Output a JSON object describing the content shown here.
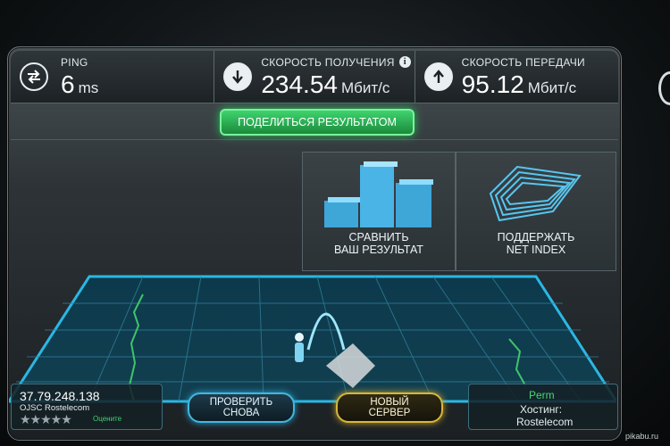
{
  "stats": {
    "ping": {
      "label": "PING",
      "value": "6",
      "unit": "ms"
    },
    "download": {
      "label": "СКОРОСТЬ ПОЛУЧЕНИЯ",
      "value": "234.54",
      "unit": "Мбит/с"
    },
    "upload": {
      "label": "СКОРОСТЬ ПЕРЕДАЧИ",
      "value": "95.12",
      "unit": "Мбит/с"
    }
  },
  "share_label": "ПОДЕЛИТЬСЯ РЕЗУЛЬТАТОМ",
  "panels": {
    "compare": {
      "line1": "СРАВНИТЬ",
      "line2": "ВАШ РЕЗУЛЬТАТ"
    },
    "netindex": {
      "line1": "ПОДДЕРЖАТЬ",
      "line2": "NET INDEX"
    }
  },
  "client": {
    "ip": "37.79.248.138",
    "isp": "OJSC Rostelecom",
    "stars": "★★★★★",
    "rate_label": "Оцените"
  },
  "buttons": {
    "again": {
      "line1": "ПРОВЕРИТЬ",
      "line2": "СНОВА"
    },
    "server": {
      "line1": "НОВЫЙ",
      "line2": "СЕРВЕР"
    }
  },
  "server": {
    "city": "Perm",
    "host_label": "Хостинг:",
    "host_value": "Rostelecom"
  },
  "watermark": "pikabu.ru",
  "colors": {
    "accent_green": "#3fd36e",
    "accent_blue": "#42b7df",
    "accent_gold": "#d9b63a"
  }
}
